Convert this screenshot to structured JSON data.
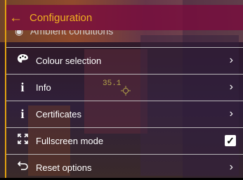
{
  "header": {
    "title": "Configuration",
    "back_icon": "arrow-left-icon"
  },
  "partial_item": {
    "label": "Ambient conditions",
    "icon": "ambient-icon"
  },
  "overlay": {
    "temperature": "35.1"
  },
  "menu": [
    {
      "id": "colour-selection",
      "label": "Colour selection",
      "icon": "palette-icon",
      "control": "chevron-right-icon"
    },
    {
      "id": "info",
      "label": "Info",
      "icon": "info-icon",
      "control": "chevron-right-icon"
    },
    {
      "id": "certificates",
      "label": "Certificates",
      "icon": "info-icon",
      "control": "chevron-right-icon"
    },
    {
      "id": "fullscreen-mode",
      "label": "Fullscreen mode",
      "icon": "fullscreen-icon",
      "control": "checkbox",
      "checked": true
    },
    {
      "id": "reset-options",
      "label": "Reset options",
      "icon": "reset-icon",
      "control": "chevron-right-icon"
    }
  ],
  "colors": {
    "accent": "#f0b020",
    "header_bg": "#780a3c",
    "divider": "#cfcfcf"
  }
}
